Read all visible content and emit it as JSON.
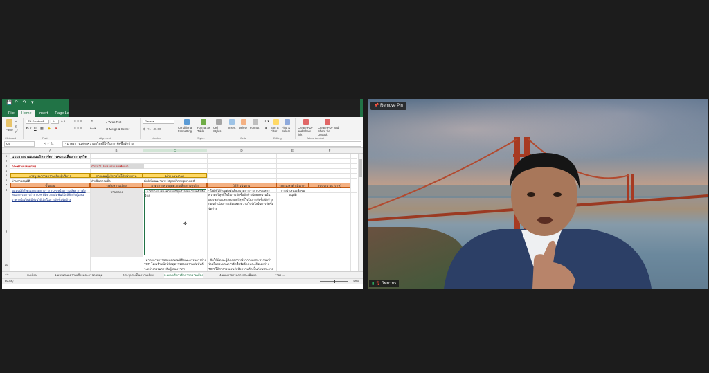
{
  "excel": {
    "quick_access": "💾 ↶ · ↷ · ▾",
    "menu": [
      "File",
      "Home",
      "Insert",
      "Page Layo"
    ],
    "ribbon": {
      "font_name": "TH SarabunP...",
      "font_size": "14",
      "wrap_text": "Wrap Text",
      "merge_center": "Merge & Center",
      "number_format": "General",
      "conditional_formatting": "Conditional Formatting",
      "format_as_table": "Format as Table",
      "cell_styles": "Cell Styles",
      "insert": "Insert",
      "delete": "Delete",
      "format": "Format",
      "sort_filter": "Sort & Filter",
      "find_select": "Find & Select",
      "create_pdf_share": "Create PDF and Share link",
      "create_pdf_outlook": "Create PDF and Share via Outlook",
      "paste": "Paste",
      "groups": [
        "Clipboard",
        "Font",
        "Alignment",
        "Number",
        "Styles",
        "Cells",
        "Editing",
        "Adobe Acrobat"
      ]
    },
    "name_box": "C9",
    "formula": "- มาตรการแสดงความบริสุทธิ์ใจในการจัดซื้อจัดจ้าง",
    "columns": [
      "A",
      "B",
      "C",
      "D",
      "E",
      "F"
    ],
    "rows": [
      "1",
      "2",
      "3",
      "4",
      "5",
      "6",
      "7",
      "8",
      "9",
      "10"
    ],
    "cells": {
      "r1": "แบบรายงานแผนบริหารจัดการความเสี่ยงการทุจริต",
      "r3a": "กระทรวงมหาดไทย",
      "r3b": "การนำไปแผนงานแผนพัฒนา",
      "r5a": "การบูรณาการความเสี่ยงผู้บริหาร",
      "r5b": "การแผนผู้บริหารในใส่หน่วยงาน",
      "r5c": "Link แผนงานฯ",
      "r6a": "ผ่านการอนุมัติ",
      "r6b": "ดำเนินการแล้ว",
      "r6c": "Link ที่แผนงานฯ : https://www.pcn.co.th",
      "hdr_a": "ขั้นตอน",
      "hdr_b": "ระดับความเสี่ยง",
      "hdr_c": "มาตรการควบคุมความเสี่ยงการทุจริต",
      "hdr_d": "วิธีดำเนินการ",
      "hdr_e": "ระยะเวลาดำเนินการ",
      "hdr_f": "งบประมาณ (บาท)",
      "r9a": "ขออนุมัติตั้งคณะกรรมการร่าง TOR หรือความเสี่ยง การตั้งคณะกรรมการร่าง TOR ที่มีความสัมพันธ์ใกล้ชิดกับผู้เสนอราคาหรือเป็นผู้มีส่วนได้เสียในการจัดซื้อจัดจ้าง",
      "r9b": "ปานกลาง",
      "r9c": "- มาตรการแสดงความบริสุทธิ์ใจในการจัดซื้อจัดจ้าง",
      "r9d": "- ให้ผู้ที่ได้รับแต่งตั้งเป็นกรรมการร่าง TOR แสดงความบริสุทธิ์ใจในการจัดซื้อจัดจ้างโดยลงนามในแบบฟอร์มแสดงความบริสุทธิ์ใจในการจัดซื้อจัดจ้างก่อนดำเนินการ เพื่อแสดงความโปร่งใสในการจัดซื้อจัดจ้าง",
      "r9e": "การนำเสนอเพื่อขออนุมัติ",
      "r9f": "-",
      "r10c": "- มาตรการตรวจสอบคุณสมบัติคณะกรรมการร่าง TOR โดยเจ้าหน้าที่พัสดุตรวจสอบความสัมพันธ์ระหว่างกรรมการกับผู้เสนอราคา",
      "r10d": "- จัดให้มีคณะผู้สังเกตการณ์จากภาคประชาชนเข้าร่วมในกระบวนการจัดซื้อจัดจ้าง และเปิดเผยร่าง TOR ให้สาธารณชนรับฟังความคิดเห็นก่อนประกาศ"
    },
    "sheet_tabs": [
      "ทะเบียน",
      "1.แบบเสนอความเสี่ยงและการควบคุม",
      "2.ระบุประเด็นความเสี่ยง",
      "3.แผนบริหารจัดการความเสี่ยง",
      "4.แบบรายงานการประเมินผล",
      "รายง ..."
    ],
    "status": "Ready",
    "zoom": "90%"
  },
  "video": {
    "pin_label": "Remove Pin",
    "participant_name": "วิทยากร"
  },
  "colors": {
    "excel_green": "#217346",
    "header_yellow": "#ffd966",
    "header_orange": "#f4b183",
    "dark_bg": "#1c1c1c"
  }
}
